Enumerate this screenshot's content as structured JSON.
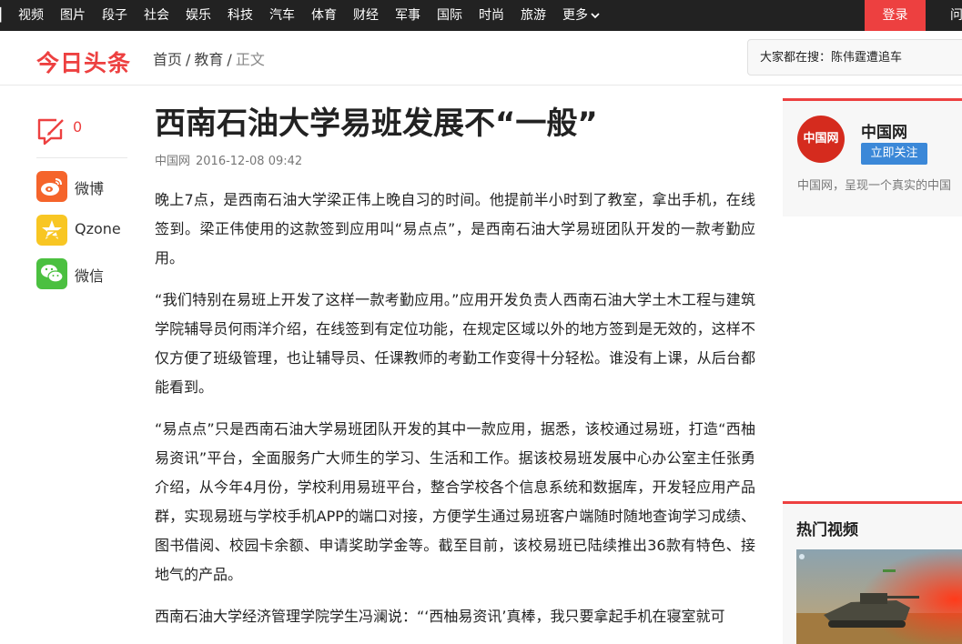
{
  "topnav": {
    "items": [
      "视频",
      "图片",
      "段子",
      "社会",
      "娱乐",
      "科技",
      "汽车",
      "体育",
      "财经",
      "军事",
      "国际",
      "时尚",
      "旅游",
      "更多"
    ],
    "login_label": "登录",
    "right_partial": "问"
  },
  "header": {
    "logo_text": "今日头条",
    "breadcrumb": {
      "home": "首页",
      "section": "教育",
      "current": "正文"
    },
    "search_placeholder": "大家都在搜：陈伟霆遭追车"
  },
  "share": {
    "comment_count": "0",
    "items": [
      {
        "label": "微博",
        "icon": "weibo-icon",
        "color": "#f5642b"
      },
      {
        "label": "Qzone",
        "icon": "qzone-icon",
        "color": "#f8c623"
      },
      {
        "label": "微信",
        "icon": "wechat-icon",
        "color": "#4bc040"
      }
    ]
  },
  "article": {
    "title": "西南石油大学易班发展不“一般”",
    "source": "中国网",
    "time": "2016-12-08 09:42",
    "paragraphs": [
      "晚上7点，是西南石油大学梁正伟上晚自习的时间。他提前半小时到了教室，拿出手机，在线签到。梁正伟使用的这款签到应用叫“易点点”，是西南石油大学易班团队开发的一款考勤应用。",
      "“我们特别在易班上开发了这样一款考勤应用。”应用开发负责人西南石油大学土木工程与建筑学院辅导员何雨洋介绍，在线签到有定位功能，在规定区域以外的地方签到是无效的，这样不仅方便了班级管理，也让辅导员、任课教师的考勤工作变得十分轻松。谁没有上课，从后台都能看到。",
      "“易点点”只是西南石油大学易班团队开发的其中一款应用，据悉，该校通过易班，打造“西柚易资讯”平台，全面服务广大师生的学习、生活和工作。据该校易班发展中心办公室主任张勇介绍，从今年4月份，学校利用易班平台，整合学校各个信息系统和数据库，开发轻应用产品群，实现易班与学校手机APP的端口对接，方便学生通过易班客户端随时随地查询学习成绩、图书借阅、校园卡余额、申请奖助学金等。截至目前，该校易班已陆续推出36款有特色、接地气的产品。",
      "西南石油大学经济管理学院学生冯澜说：“‘西柚易资讯’真棒，我只要拿起手机在寝室就可"
    ]
  },
  "sidebar": {
    "media_avatar_text": "中国网",
    "media_name": "中国网",
    "follow_label": "立即关注",
    "media_desc": "中国网，呈现一个真实的中国",
    "hot_video_title": "热门视频"
  },
  "colors": {
    "brand": "#ed4040",
    "nav_bg": "#222222",
    "follow": "#3b88d8"
  }
}
